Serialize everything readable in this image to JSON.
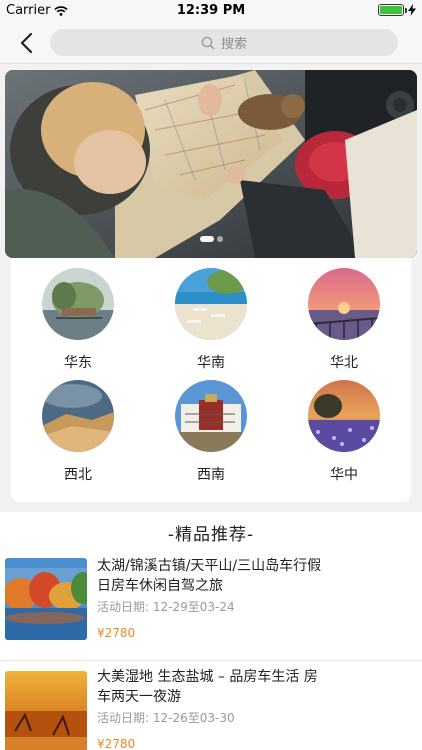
{
  "status_bar": {
    "carrier": "Carrier",
    "time": "12:39 PM",
    "battery_level": 1.0
  },
  "nav": {
    "back_icon": "chevron-left-icon",
    "search_placeholder": "搜索",
    "search_icon": "search-icon"
  },
  "banner": {
    "page_count": 2,
    "active_page": 1
  },
  "regions": [
    {
      "label": "华东"
    },
    {
      "label": "华南"
    },
    {
      "label": "华北"
    },
    {
      "label": "西北"
    },
    {
      "label": "西南"
    },
    {
      "label": "华中"
    }
  ],
  "recommend": {
    "title": "-精品推荐-",
    "items": [
      {
        "title": "太湖/锦溪古镇/天平山/三山岛车行假日房车休闲自驾之旅",
        "date": "活动日期:  12-29至03-24",
        "price": "¥2780"
      },
      {
        "title": "大美湿地    生态盐城 – 品房车生活 房车两天一夜游",
        "date": "活动日期:  12-26至03-30",
        "price": "¥2780"
      }
    ]
  },
  "colors": {
    "price": "#ee8a1e",
    "battery": "#3cc43c",
    "background": "#f2f2f2"
  }
}
